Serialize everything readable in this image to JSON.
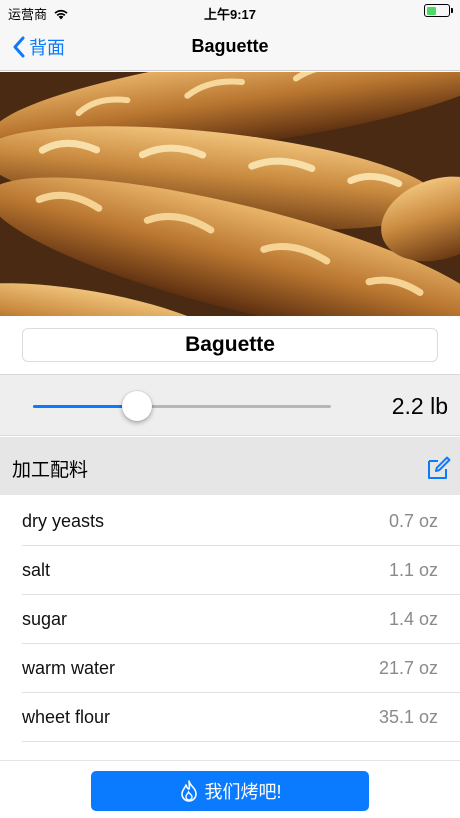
{
  "status_bar": {
    "carrier": "运营商",
    "time": "上午9:17",
    "battery_level": 0.45
  },
  "nav": {
    "back_label": "背面",
    "title": "Baguette"
  },
  "recipe": {
    "name": "Baguette"
  },
  "weight": {
    "value_label": "2.2 lb",
    "slider_fraction": 0.35
  },
  "ingredients": {
    "header": "加工配料",
    "items": [
      {
        "name": "dry yeasts",
        "amount": "0.7 oz"
      },
      {
        "name": "salt",
        "amount": "1.1 oz"
      },
      {
        "name": "sugar",
        "amount": "1.4 oz"
      },
      {
        "name": "warm water",
        "amount": "21.7 oz"
      },
      {
        "name": "wheet flour",
        "amount": "35.1 oz"
      }
    ]
  },
  "action": {
    "bake_label": "我们烤吧!"
  },
  "colors": {
    "accent": "#0a7aff",
    "battery_green": "#4cd964"
  }
}
